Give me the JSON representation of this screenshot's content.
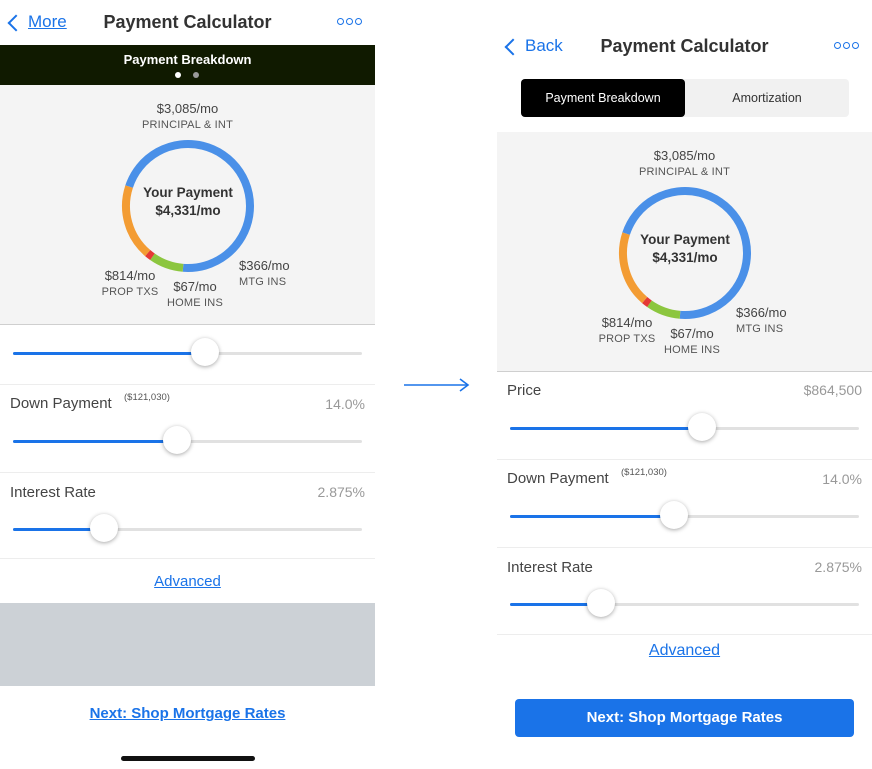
{
  "colors": {
    "accent": "#1a73e8",
    "principal": "#4a90e8",
    "prop_tax": "#f39c33",
    "home_ins": "#e53935",
    "mtg_ins": "#8cc63f",
    "dark_header": "#101a00"
  },
  "left": {
    "nav": {
      "back_label": "More",
      "title": "Payment Calculator",
      "menu_icon": "more-dots-icon"
    },
    "banner": {
      "title": "Payment Breakdown",
      "page_dots": 2,
      "active_dot": 0
    },
    "chart": {
      "center_title": "Your Payment",
      "center_value": "$4,331/mo",
      "principal": {
        "value": "$3,085/mo",
        "caption": "PRINCIPAL & INT"
      },
      "prop_tax": {
        "value": "$814/mo",
        "caption": "PROP TXS"
      },
      "home_ins": {
        "value": "$67/mo",
        "caption": "HOME INS"
      },
      "mtg_ins": {
        "value": "$366/mo",
        "caption": "MTG INS"
      }
    },
    "sliders": {
      "price": {
        "fraction": 0.55
      },
      "down_payment": {
        "label": "Down Payment",
        "sub": "($121,030)",
        "value": "14.0%",
        "fraction": 0.47
      },
      "interest_rate": {
        "label": "Interest Rate",
        "value": "2.875%",
        "fraction": 0.26
      }
    },
    "advanced_link": "Advanced",
    "next_link": "Next: Shop Mortgage Rates"
  },
  "right": {
    "nav": {
      "back_label": "Back",
      "title": "Payment Calculator",
      "menu_icon": "more-dots-icon"
    },
    "tabs": [
      {
        "label": "Payment Breakdown",
        "active": true
      },
      {
        "label": "Amortization",
        "active": false
      }
    ],
    "chart": {
      "center_title": "Your Payment",
      "center_value": "$4,331/mo",
      "principal": {
        "value": "$3,085/mo",
        "caption": "PRINCIPAL & INT"
      },
      "prop_tax": {
        "value": "$814/mo",
        "caption": "PROP TXS"
      },
      "home_ins": {
        "value": "$67/mo",
        "caption": "HOME INS"
      },
      "mtg_ins": {
        "value": "$366/mo",
        "caption": "MTG INS"
      }
    },
    "sliders": {
      "price": {
        "label": "Price",
        "value": "$864,500",
        "fraction": 0.55
      },
      "down_payment": {
        "label": "Down Payment",
        "sub": "($121,030)",
        "value": "14.0%",
        "fraction": 0.47
      },
      "interest_rate": {
        "label": "Interest Rate",
        "value": "2.875%",
        "fraction": 0.26
      }
    },
    "advanced_link": "Advanced",
    "next_button": "Next: Shop Mortgage Rates"
  },
  "transition_arrow_icon": "right-arrow-icon"
}
